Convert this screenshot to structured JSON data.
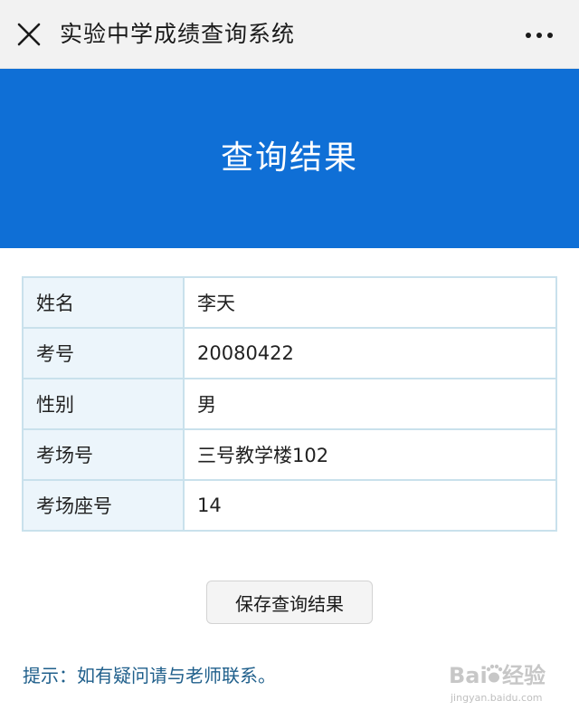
{
  "app": {
    "title": "实验中学成绩查询系统"
  },
  "banner": {
    "title": "查询结果"
  },
  "result": {
    "rows": [
      {
        "label": "姓名",
        "value": "李天"
      },
      {
        "label": "考号",
        "value": "20080422"
      },
      {
        "label": "性别",
        "value": "男"
      },
      {
        "label": "考场号",
        "value": "三号教学楼102"
      },
      {
        "label": "考场座号",
        "value": "14"
      }
    ]
  },
  "actions": {
    "save_label": "保存查询结果"
  },
  "hint": {
    "text": "提示：如有疑问请与老师联系。"
  },
  "watermark": {
    "logo_text": "Baidu经验",
    "url": "jingyan.baidu.com"
  },
  "colors": {
    "banner": "#0f6fd6",
    "label_cell": "#ecf5fb",
    "table_border": "#c9e1ec",
    "hint_text": "#1f5f8b"
  },
  "icons": {
    "close": "close-icon",
    "more": "more-icon"
  }
}
